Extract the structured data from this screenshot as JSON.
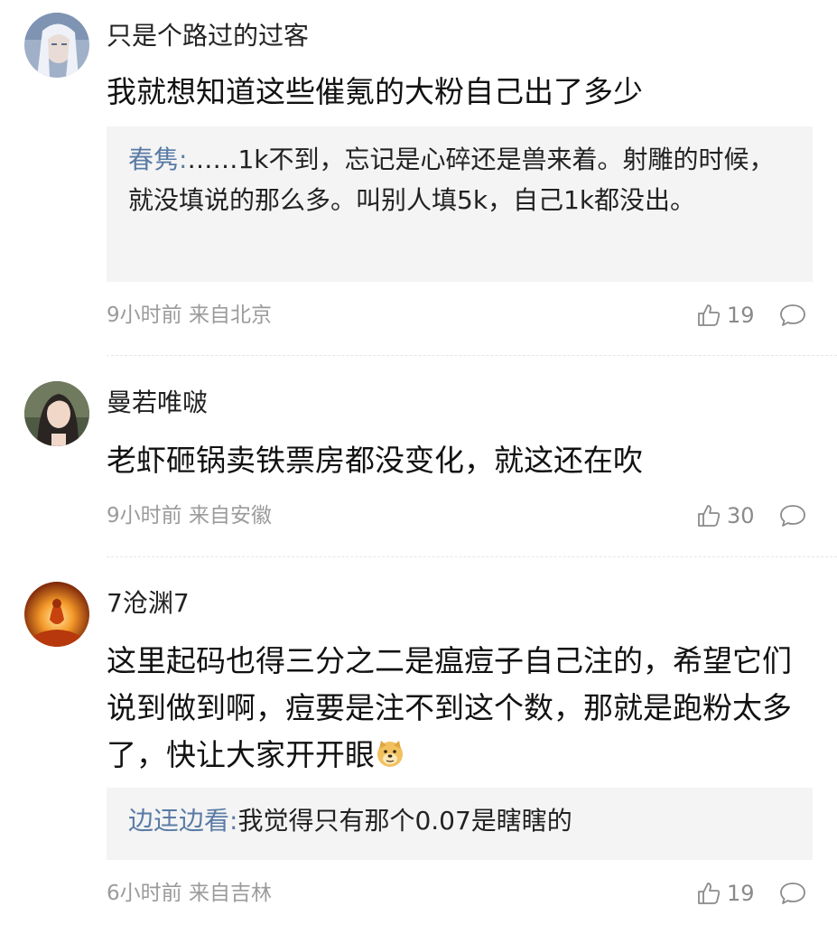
{
  "comments": [
    {
      "username": "只是个路过的过客",
      "text": "我就想知道这些催氪的大粉自己出了多少",
      "reply": {
        "name": "春隽",
        "sep": ":",
        "text": "……1k不到，忘记是心碎还是兽来着。射雕的时候，就没填说的那么多。叫别人填5k，自己1k都没出。"
      },
      "time": "9小时前",
      "location": "来自北京",
      "likes": "19"
    },
    {
      "username": "曼若唯啵",
      "text": "老虾砸锅卖铁票房都没变化，就这还在吹",
      "time": "9小时前",
      "location": "来自安徽",
      "likes": "30"
    },
    {
      "username": "7沧渊7",
      "text": "这里起码也得三分之二是瘟痘子自己注的，希望它们说到做到啊，痘要是注不到这个数，那就是跑粉太多了，快让大家开开眼",
      "emoji": "doge-emoji-icon",
      "reply": {
        "name": "边迋边看",
        "sep": ":",
        "text": "我觉得只有那个0.07是瞎瞎的"
      },
      "time": "6小时前",
      "location": "来自吉林",
      "likes": "19"
    }
  ],
  "colors": {
    "reply_name": "#5a7ba5",
    "meta_text": "#9b9b9b",
    "reply_bg": "#f4f4f4"
  },
  "icons": {
    "like": "thumbs-up-icon",
    "reply": "comment-bubble-icon"
  }
}
